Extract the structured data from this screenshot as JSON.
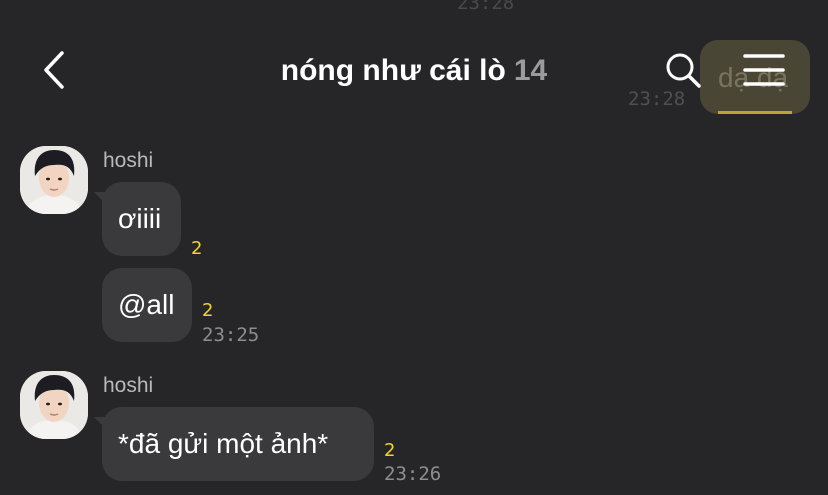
{
  "background": {
    "ghost_time_top": "23:28",
    "ghost_bubble_text": "dạ đạ",
    "ghost_time": "23:28"
  },
  "header": {
    "title": "nóng như cái lò",
    "member_count": "14",
    "back_icon": "chevron-left-icon",
    "search_icon": "search-icon",
    "menu_icon": "hamburger-menu-icon"
  },
  "messages": [
    {
      "sender": "hoshi",
      "bubbles": [
        {
          "text": "ơiiii",
          "unread": "2",
          "time": ""
        },
        {
          "text": "@all",
          "unread": "2",
          "time": "23:25"
        }
      ]
    },
    {
      "sender": "hoshi",
      "bubbles": [
        {
          "text": "*đã gửi một ảnh*",
          "unread": "2",
          "time": "23:26"
        }
      ]
    }
  ],
  "colors": {
    "background": "#262628",
    "bubble": "#3a3a3c",
    "unread": "#f2d526",
    "time": "#8e8e90",
    "count": "#9b9b9d"
  }
}
